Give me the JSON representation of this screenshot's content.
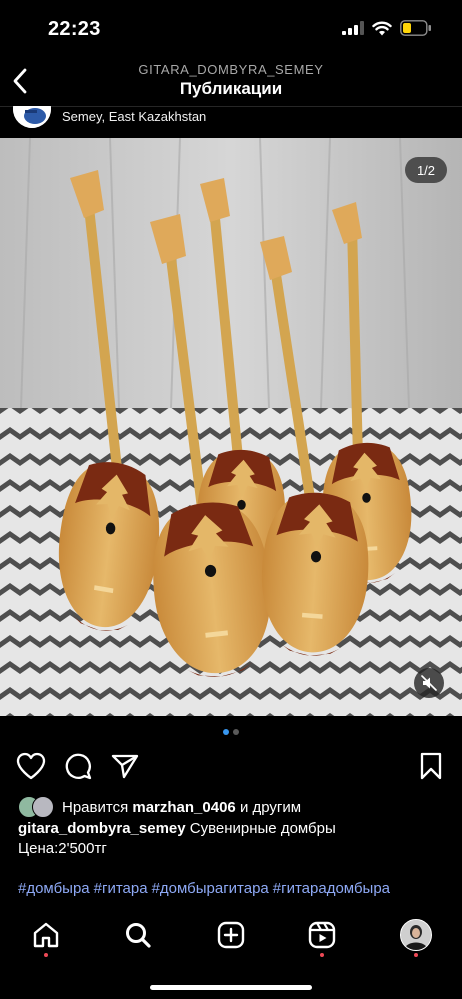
{
  "status": {
    "time": "22:23"
  },
  "header": {
    "account": "GITARA_DOMBYRA_SEMEY",
    "title": "Публикации"
  },
  "post": {
    "location": "Semey, East Kazakhstan",
    "photo_counter": "1/2",
    "slide_count": 2,
    "active_slide": 1,
    "likes_prefix": "Нравится",
    "liked_by": "marzhan_0406",
    "likes_suffix": "и другим",
    "username": "gitara_dombyra_semey",
    "caption_text": "Сувенирные домбры",
    "price_line": "Цена:2'500тг",
    "hashtags": [
      "#домбыра",
      "#гитара",
      "#домбырагитара",
      "#гитарадомбыра"
    ]
  },
  "icons": {
    "back": "chevron-left-icon",
    "like": "heart-icon",
    "comment": "comment-icon",
    "share": "send-icon",
    "save": "bookmark-icon",
    "mute": "speaker-muted-icon",
    "tabs": [
      "home-icon",
      "search-icon",
      "new-post-icon",
      "reels-icon",
      "profile-avatar"
    ]
  },
  "colors": {
    "background": "#000000",
    "hashtag": "#8ea9f5",
    "active_dot": "#3897f0",
    "notification_dot": "#ed4956",
    "battery": "#ffd60a"
  }
}
